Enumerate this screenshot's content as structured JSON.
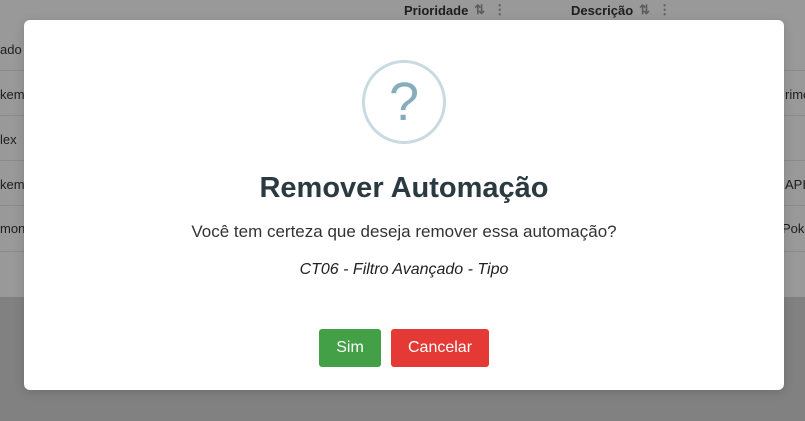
{
  "background_table": {
    "columns": [
      {
        "label": "Prioridade"
      },
      {
        "label": "Descrição"
      }
    ],
    "left_fragments": [
      "ado -",
      "kemo",
      "lex",
      "kemo",
      "mons"
    ],
    "right_fragments": [
      "rime",
      "API",
      "Poke"
    ]
  },
  "dialog": {
    "icon": "question-mark-icon",
    "icon_glyph": "?",
    "title": "Remover Automação",
    "question": "Você tem certeza que deseja remover essa automação?",
    "item_name": "CT06 - Filtro Avançado - Tipo",
    "confirm_label": "Sim",
    "cancel_label": "Cancelar"
  },
  "colors": {
    "confirm": "#43a047",
    "cancel": "#e53935",
    "icon": "#87adbd"
  }
}
